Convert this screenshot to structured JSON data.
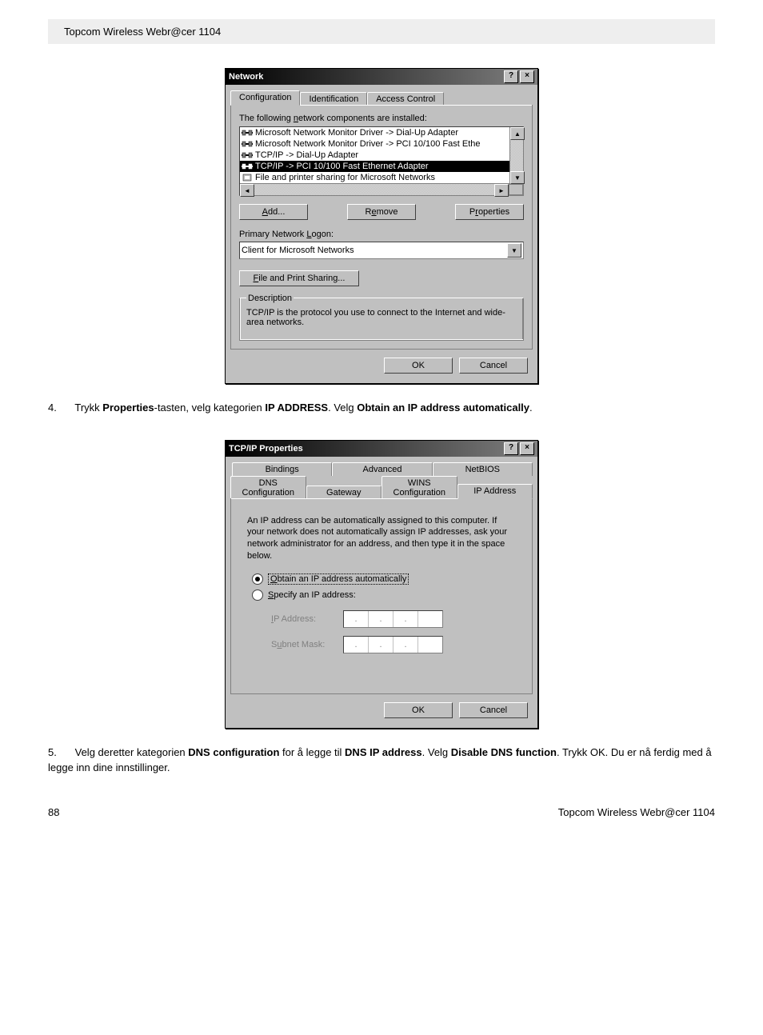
{
  "header": {
    "product": "Topcom Wireless Webr@cer 1104"
  },
  "dialog1": {
    "title": "Network",
    "tabs": [
      "Configuration",
      "Identification",
      "Access Control"
    ],
    "list_label": "The following network components are installed:",
    "list_items": [
      "Microsoft Network Monitor Driver -> Dial-Up Adapter",
      "Microsoft Network Monitor Driver -> PCI 10/100 Fast Ethe",
      "TCP/IP -> Dial-Up Adapter",
      "TCP/IP -> PCI 10/100 Fast Ethernet Adapter",
      "File and printer sharing for Microsoft Networks"
    ],
    "selected_index": 3,
    "btn_add": "Add...",
    "btn_remove": "Remove",
    "btn_properties": "Properties",
    "primary_logon_label": "Primary Network Logon:",
    "primary_logon_value": "Client for Microsoft Networks",
    "btn_fps": "File and Print Sharing...",
    "desc_title": "Description",
    "desc_text": "TCP/IP is the protocol you use to connect to the Internet and wide-area networks.",
    "btn_ok": "OK",
    "btn_cancel": "Cancel"
  },
  "step4": {
    "num": "4.",
    "pre": "Trykk ",
    "bold1": "Properties",
    "mid1": "-tasten, velg kategorien ",
    "bold2": "IP ADDRESS",
    "mid2": ". Velg ",
    "bold3": "Obtain an IP address automatically",
    "post": "."
  },
  "dialog2": {
    "title": "TCP/IP Properties",
    "tabs_row1": [
      "Bindings",
      "Advanced",
      "NetBIOS"
    ],
    "tabs_row2": [
      "DNS Configuration",
      "Gateway",
      "WINS Configuration",
      "IP Address"
    ],
    "active_tab": "IP Address",
    "info_text": "An IP address can be automatically assigned to this computer. If your network does not automatically assign IP addresses, ask your network administrator for an address, and then type it in the space below.",
    "radio_obtain": "Obtain an IP address automatically",
    "radio_specify": "Specify an IP address:",
    "ip_label": "IP Address:",
    "subnet_label": "Subnet Mask:",
    "btn_ok": "OK",
    "btn_cancel": "Cancel"
  },
  "step5": {
    "num": "5.",
    "pre": "Velg deretter kategorien ",
    "bold1": "DNS configuration",
    "mid1": " for å legge til ",
    "bold2": "DNS IP address",
    "mid2": ". Velg ",
    "bold3": "Disable DNS function",
    "post": ". Trykk OK. Du er nå ferdig med å legge inn dine innstillinger."
  },
  "footer": {
    "page": "88",
    "product": "Topcom Wireless Webr@cer 1104"
  }
}
